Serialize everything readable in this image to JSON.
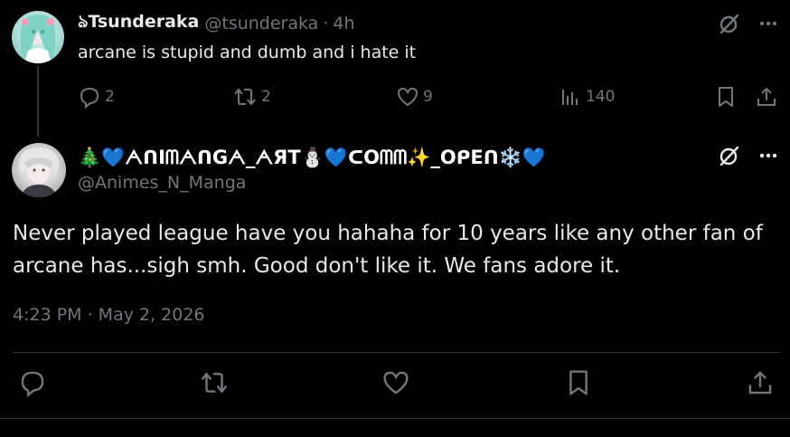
{
  "parent_tweet": {
    "display_name": "ঌTsunderaka",
    "handle": "@tsunderaka",
    "separator": "·",
    "time": "4h",
    "text": "arcane is stupid and dumb and i hate it",
    "replies": "2",
    "reposts": "2",
    "likes": "9",
    "views": "140"
  },
  "main_tweet": {
    "display_name": "🎄💙ᗅᑎIᗰᗅᑎGᗅ_ᗅЯT⛄💙ᑕOᗰᗰ✨_OᑭEᑎ❄️💙",
    "handle": "@Animes_N_Manga",
    "text_lines": [
      "Never played league have you hahaha for 10 years like any other fan of",
      "arcane has...sigh smh. Good don't like it. We fans adore it."
    ],
    "timestamp": "4:23 PM · May 2, 2026"
  },
  "colors": {
    "background": "#000000",
    "text_primary": "#e7e9ea",
    "text_secondary": "#71767b",
    "divider": "#2f3336",
    "thread_line": "#333639"
  },
  "icons": {
    "reply": "reply-icon",
    "repost": "repost-icon",
    "like": "heart-icon",
    "views": "views-icon",
    "bookmark": "bookmark-icon",
    "share": "share-icon",
    "grok": "grok-icon",
    "more": "more-icon"
  }
}
